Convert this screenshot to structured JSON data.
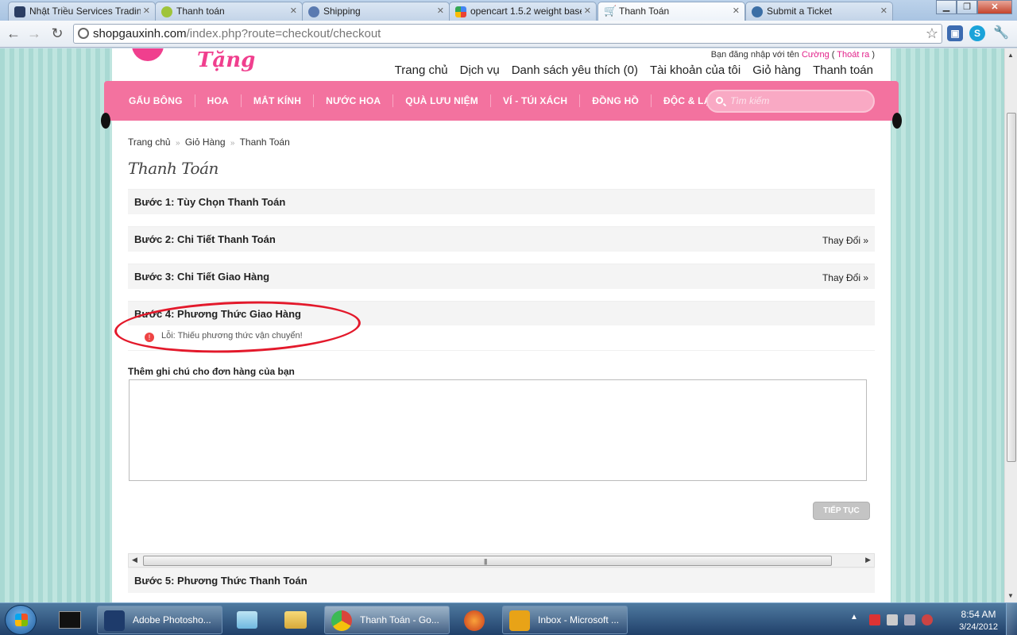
{
  "browser": {
    "tabs": [
      {
        "title": "Nhật Triều Services Tradin",
        "icon": "nt-logo-icon",
        "color": "#2b3e63"
      },
      {
        "title": "Thanh toán",
        "icon": "shop-icon",
        "color": "#9fc43a"
      },
      {
        "title": "Shipping",
        "icon": "globe-icon",
        "color": "#5a7ab0"
      },
      {
        "title": "opencart 1.5.2 weight base",
        "icon": "google-icon",
        "color": "#4285f4"
      },
      {
        "title": "Thanh Toán",
        "icon": "cart-icon",
        "color": "#777777"
      },
      {
        "title": "Submit a Ticket",
        "icon": "gear-icon",
        "color": "#3b6ea5"
      }
    ],
    "active_tab": 4,
    "url_host": "shopgauxinh.com",
    "url_path": "/index.php?route=checkout/checkout"
  },
  "page": {
    "logo_text": "Shop Quà Tặng",
    "login_prefix": "Bạn đăng nhập với tên",
    "login_user": "Cường",
    "login_paren_open": "(",
    "logout_label": "Thoát ra",
    "login_paren_close": ")",
    "toplinks": [
      "Trang chủ",
      "Dịch vụ",
      "Danh sách yêu thích (0)",
      "Tài khoản của tôi",
      "Giỏ hàng",
      "Thanh toán"
    ],
    "nav": [
      "GẤU BÔNG",
      "HOA",
      "MẮT KÍNH",
      "NƯỚC HOA",
      "QUÀ LƯU NIỆM",
      "VÍ - TÚI XÁCH",
      "ĐỒNG HỒ",
      "ĐỘC & LẠ"
    ],
    "search_placeholder": "Tìm kiếm",
    "breadcrumb": [
      "Trang chủ",
      "Giỏ Hàng",
      "Thanh Toán"
    ],
    "breadcrumb_sep": "»",
    "title": "Thanh Toán",
    "steps": [
      {
        "label": "Bước 1: Tùy Chọn Thanh Toán",
        "change": ""
      },
      {
        "label": "Bước 2: Chi Tiết Thanh Toán",
        "change": "Thay Đổi »"
      },
      {
        "label": "Bước 3: Chi Tiết Giao Hàng",
        "change": "Thay Đổi »"
      },
      {
        "label": "Bước 4: Phương Thức Giao Hàng",
        "change": ""
      }
    ],
    "error_text": "Lỗi: Thiếu phương thức vận chuyển!",
    "note_label": "Thêm ghi chú cho đơn hàng của bạn",
    "note_value": "",
    "continue_label": "TIẾP TỤC",
    "step5_label": "Bước 5: Phương Thức Thanh Toán"
  },
  "taskbar": {
    "tasks": [
      {
        "label": "Adobe Photosho...",
        "icon": "photoshop-icon",
        "color": "#1e3b6b"
      },
      {
        "label": "Thanh Toán - Go...",
        "icon": "chrome-icon",
        "color": "#d9463b"
      },
      {
        "label": "Inbox - Microsoft ...",
        "icon": "outlook-icon",
        "color": "#e8a317"
      }
    ],
    "time": "8:54 AM",
    "date": "3/24/2012"
  },
  "colors": {
    "nav_pink": "#f3729f",
    "brand_pink": "#f03f8e",
    "annotation_red": "#e3192b"
  }
}
